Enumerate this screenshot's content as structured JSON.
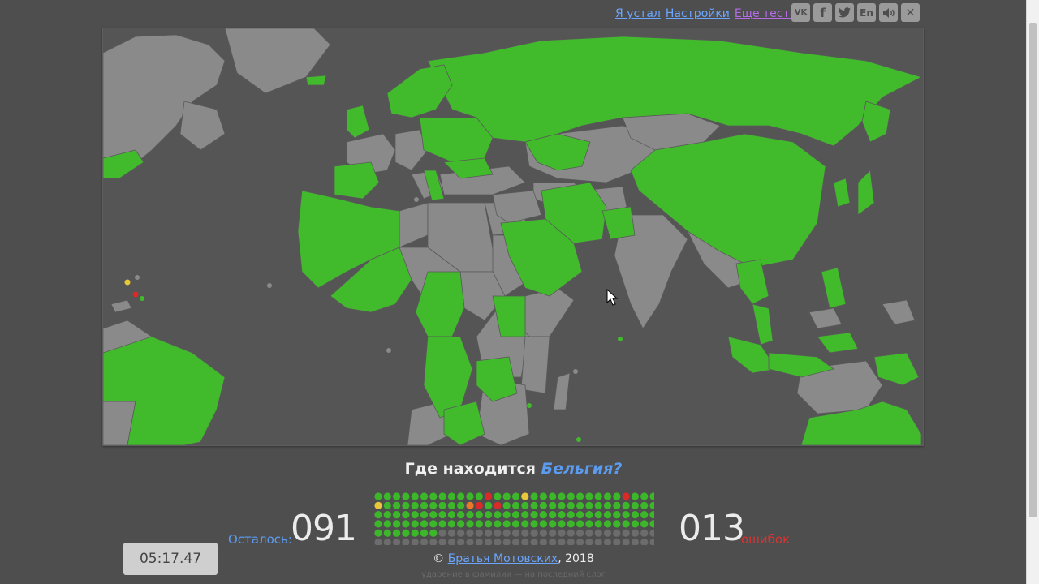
{
  "top_links": {
    "tired": "Я устал",
    "settings": "Настройки",
    "more_tests": "Еще тесты"
  },
  "social": {
    "vk": "vk",
    "facebook": "f",
    "twitter": "t",
    "lang": "En",
    "sound": "sound",
    "close": "✕"
  },
  "question": {
    "prefix": "Где находится",
    "country": "Бельгия?"
  },
  "remaining": {
    "label": "Осталось:",
    "value": "091"
  },
  "errors": {
    "value": "013",
    "label": "ошибок"
  },
  "timer": "05:17.47",
  "progress": {
    "columns": 31,
    "rows": 6,
    "colors": {
      "correct": "#3cb72a",
      "mistake": "#d92a2a",
      "hint": "#e8c83a",
      "partial": "#e87a2a",
      "pending": "#6c6c6c"
    },
    "cells": [
      "ggggggggggggrgggyggggggggggrggggg",
      "ygggggggggopgrgggggggggggggggggg",
      "ggggggggggggggggggggggggggggggg",
      "ggggggggggggggggggggggggggggggg",
      "gggggggnnnnnnnnnnnnnnnnnnnnnnnn",
      "nnnnnnnnnnnnnnnnnnnnnnnnnnnnnnn"
    ]
  },
  "copyright": {
    "prefix": "©",
    "link": "Братья Мотовских",
    "year": ", 2018"
  },
  "hint": "ударение в фамилии — на последний слог",
  "map_colors": {
    "ocean": "#555555",
    "guessed": "#41bb2c",
    "unguessed": "#8a8a8a",
    "border": "#5a5a5a"
  }
}
